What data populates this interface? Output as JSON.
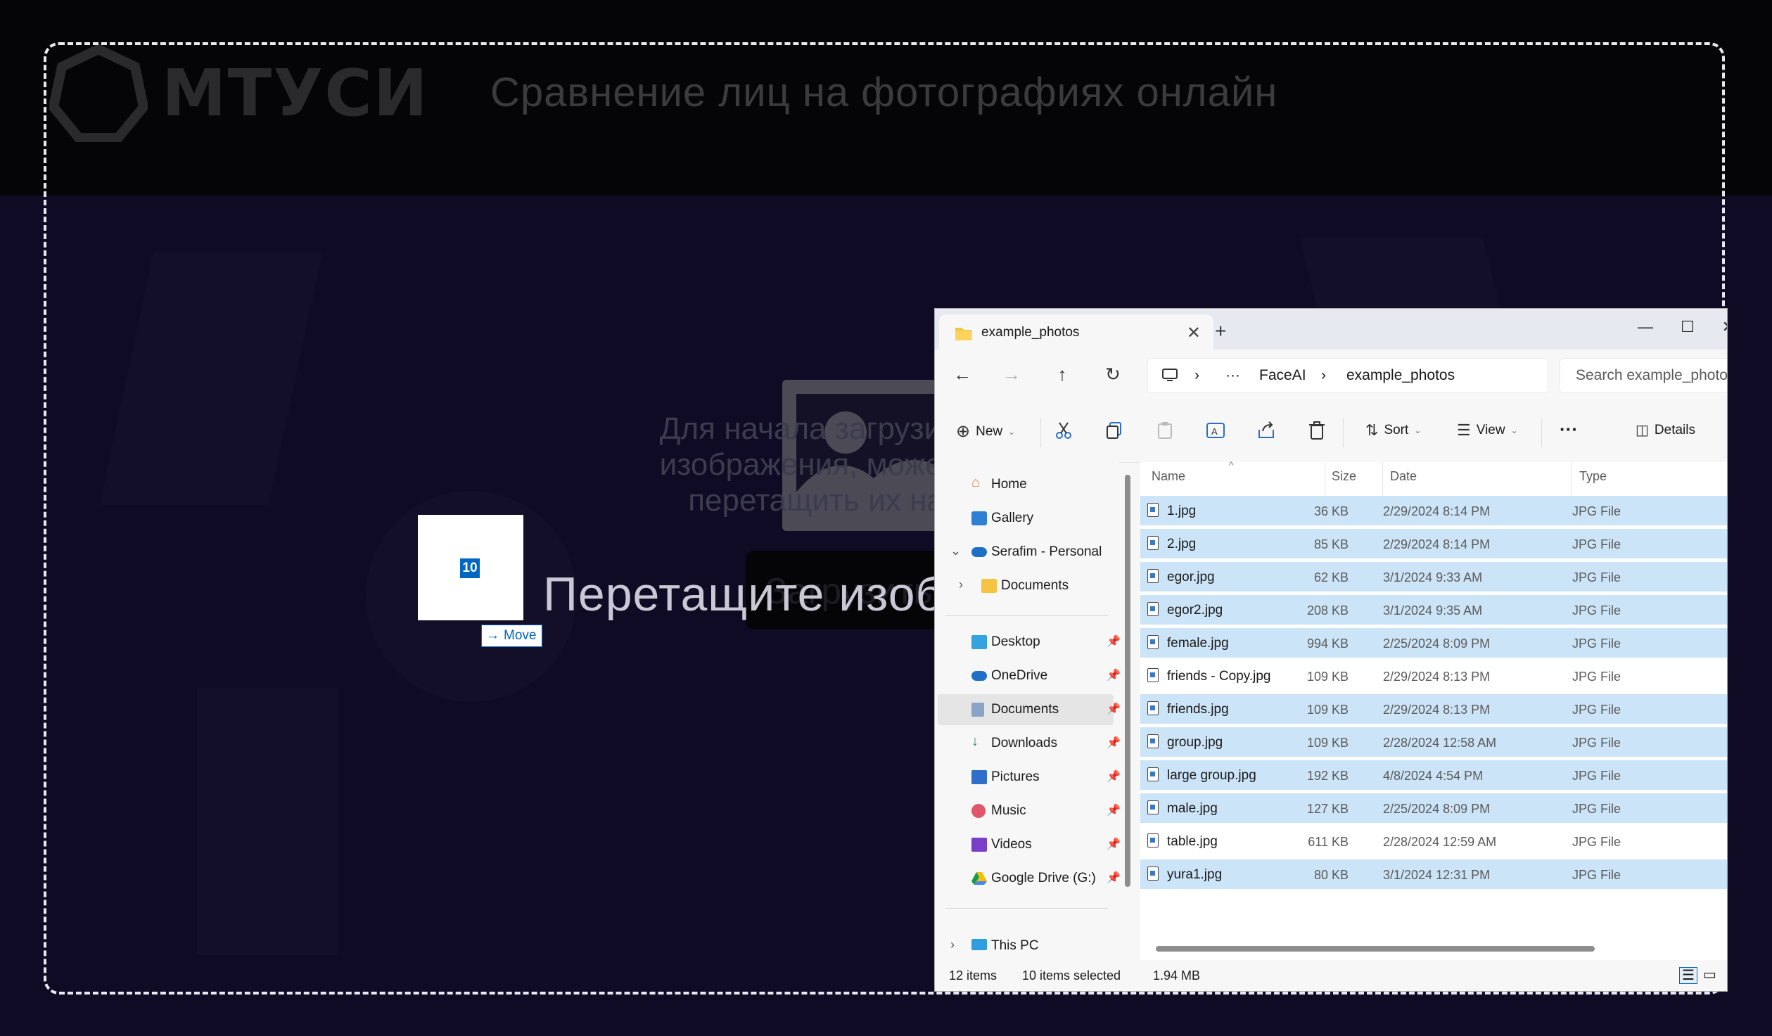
{
  "site": {
    "logo_text": "МТУСИ",
    "title": "Сравнение лиц на фотографиях онлайн",
    "instruction_lines": [
      "Для начала загрузите",
      "изображения, можете",
      "перетащить их на"
    ],
    "upload_button": "Загрузить",
    "drag_hint": "Перетащите изображение"
  },
  "drag": {
    "count": "10",
    "tooltip": "Move"
  },
  "explorer": {
    "tab_title": "example_photos",
    "window_controls": {
      "minimize": "—",
      "maximize": "☐",
      "close": "✕"
    },
    "breadcrumb": [
      "FaceAI",
      "example_photos"
    ],
    "breadcrumb_more": "···",
    "search_placeholder": "Search example_photos",
    "toolbar": {
      "new_label": "New",
      "sort_label": "Sort",
      "view_label": "View",
      "more_label": "···",
      "details_label": "Details"
    },
    "nav": {
      "home": "Home",
      "gallery": "Gallery",
      "onedrive_personal": "Serafim - Personal",
      "documents_sub": "Documents",
      "desktop": "Desktop",
      "onedrive": "OneDrive",
      "documents": "Documents",
      "downloads": "Downloads",
      "pictures": "Pictures",
      "music": "Music",
      "videos": "Videos",
      "google_drive": "Google Drive (G:)",
      "this_pc": "This PC"
    },
    "columns": {
      "name": "Name",
      "size": "Size",
      "date": "Date",
      "type": "Type"
    },
    "files": [
      {
        "name": "1.jpg",
        "size": "36 KB",
        "date": "2/29/2024 8:14 PM",
        "type": "JPG File",
        "selected": true
      },
      {
        "name": "2.jpg",
        "size": "85 KB",
        "date": "2/29/2024 8:14 PM",
        "type": "JPG File",
        "selected": true
      },
      {
        "name": "egor.jpg",
        "size": "62 KB",
        "date": "3/1/2024 9:33 AM",
        "type": "JPG File",
        "selected": true
      },
      {
        "name": "egor2.jpg",
        "size": "208 KB",
        "date": "3/1/2024 9:35 AM",
        "type": "JPG File",
        "selected": true
      },
      {
        "name": "female.jpg",
        "size": "994 KB",
        "date": "2/25/2024 8:09 PM",
        "type": "JPG File",
        "selected": true
      },
      {
        "name": "friends - Copy.jpg",
        "size": "109 KB",
        "date": "2/29/2024 8:13 PM",
        "type": "JPG File",
        "selected": false
      },
      {
        "name": "friends.jpg",
        "size": "109 KB",
        "date": "2/29/2024 8:13 PM",
        "type": "JPG File",
        "selected": true
      },
      {
        "name": "group.jpg",
        "size": "109 KB",
        "date": "2/28/2024 12:58 AM",
        "type": "JPG File",
        "selected": true
      },
      {
        "name": "large group.jpg",
        "size": "192 KB",
        "date": "4/8/2024 4:54 PM",
        "type": "JPG File",
        "selected": true
      },
      {
        "name": "male.jpg",
        "size": "127 KB",
        "date": "2/25/2024 8:09 PM",
        "type": "JPG File",
        "selected": true
      },
      {
        "name": "table.jpg",
        "size": "611 KB",
        "date": "2/28/2024 12:59 AM",
        "type": "JPG File",
        "selected": false
      },
      {
        "name": "yura1.jpg",
        "size": "80 KB",
        "date": "3/1/2024 12:31 PM",
        "type": "JPG File",
        "selected": true
      }
    ],
    "status": {
      "item_count": "12 items",
      "selected_count": "10 items selected",
      "selected_size": "1.94 MB"
    }
  },
  "colors": {
    "selection": "#cce4f7",
    "accent": "#0067c0",
    "site_background": "#100b25"
  }
}
